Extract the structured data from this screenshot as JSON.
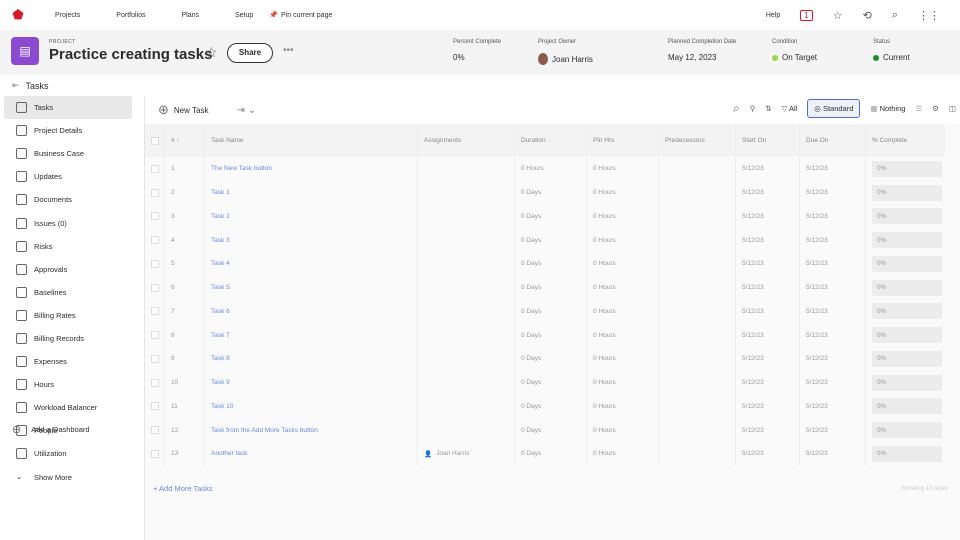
{
  "topnav": {
    "items": [
      "Projects",
      "Portfolios",
      "Plans",
      "Setup"
    ],
    "pin": "Pin current page",
    "help": "Help",
    "notifications": "1"
  },
  "header": {
    "label": "PROJECT",
    "title": "Practice creating tasks",
    "share": "Share",
    "meta": [
      {
        "k": "Percent Complete",
        "v": "0%"
      },
      {
        "k": "Project Owner",
        "v": "Joan Harris"
      },
      {
        "k": "Planned Completion Date",
        "v": "May 12, 2023"
      },
      {
        "k": "Condition",
        "v": "On Target"
      },
      {
        "k": "Status",
        "v": "Current"
      }
    ],
    "colors": {
      "on_target": "#9ad84a",
      "current": "#1c8a2e"
    }
  },
  "subhead": "Tasks",
  "sidebar": [
    "Tasks",
    "Project Details",
    "Business Case",
    "Updates",
    "Documents",
    "Issues (0)",
    "Risks",
    "Approvals",
    "Baselines",
    "Billing Rates",
    "Billing Records",
    "Expenses",
    "Hours",
    "Workload Balancer",
    "People",
    "Utilization",
    "Show More"
  ],
  "add_dashboard": "Add a Dashboard",
  "toolbar": {
    "new_task": "New Task",
    "filter": "All",
    "view": "Standard",
    "grouping": "Nothing"
  },
  "columns": [
    "#",
    "Task Name",
    "Assignments",
    "Duration",
    "Pln Hrs",
    "Predecessors",
    "Start On",
    "Due On",
    "% Complete"
  ],
  "rows": [
    {
      "n": "1",
      "name": "The New Task button",
      "assign": "",
      "dur": "0 Hours",
      "hrs": "0 Hours",
      "start": "5/12/23",
      "due": "5/12/23",
      "pct": "0%"
    },
    {
      "n": "2",
      "name": "Task 1",
      "assign": "",
      "dur": "0 Days",
      "hrs": "0 Hours",
      "start": "5/12/23",
      "due": "5/12/23",
      "pct": "0%"
    },
    {
      "n": "3",
      "name": "Task 2",
      "assign": "",
      "dur": "0 Days",
      "hrs": "0 Hours",
      "start": "5/12/23",
      "due": "5/12/23",
      "pct": "0%"
    },
    {
      "n": "4",
      "name": "Task 3",
      "assign": "",
      "dur": "0 Days",
      "hrs": "0 Hours",
      "start": "5/12/23",
      "due": "5/12/23",
      "pct": "0%"
    },
    {
      "n": "5",
      "name": "Task 4",
      "assign": "",
      "dur": "0 Days",
      "hrs": "0 Hours",
      "start": "5/12/23",
      "due": "5/12/23",
      "pct": "0%"
    },
    {
      "n": "6",
      "name": "Task 5",
      "assign": "",
      "dur": "0 Days",
      "hrs": "0 Hours",
      "start": "5/12/23",
      "due": "5/12/23",
      "pct": "0%"
    },
    {
      "n": "7",
      "name": "Task 6",
      "assign": "",
      "dur": "0 Days",
      "hrs": "0 Hours",
      "start": "5/12/23",
      "due": "5/12/23",
      "pct": "0%"
    },
    {
      "n": "8",
      "name": "Task 7",
      "assign": "",
      "dur": "0 Days",
      "hrs": "0 Hours",
      "start": "5/12/23",
      "due": "5/12/23",
      "pct": "0%"
    },
    {
      "n": "9",
      "name": "Task 8",
      "assign": "",
      "dur": "0 Days",
      "hrs": "0 Hours",
      "start": "5/12/23",
      "due": "5/12/23",
      "pct": "0%"
    },
    {
      "n": "10",
      "name": "Task 9",
      "assign": "",
      "dur": "0 Days",
      "hrs": "0 Hours",
      "start": "5/12/23",
      "due": "5/12/23",
      "pct": "0%"
    },
    {
      "n": "11",
      "name": "Task 10",
      "assign": "",
      "dur": "0 Days",
      "hrs": "0 Hours",
      "start": "5/12/23",
      "due": "5/12/23",
      "pct": "0%"
    },
    {
      "n": "12",
      "name": "Task from the Add More Tasks button",
      "assign": "",
      "dur": "0 Days",
      "hrs": "0 Hours",
      "start": "5/12/23",
      "due": "5/12/23",
      "pct": "0%"
    },
    {
      "n": "13",
      "name": "Another task",
      "assign": "Joan Harris",
      "dur": "0 Days",
      "hrs": "0 Hours",
      "start": "5/12/23",
      "due": "5/12/23",
      "pct": "0%"
    }
  ],
  "add_more": "+ Add More Tasks",
  "showing": "Showing 13 tasks"
}
